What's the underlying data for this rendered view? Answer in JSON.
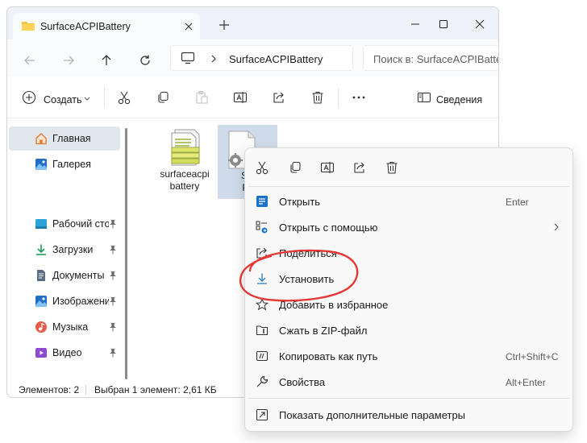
{
  "window": {
    "tab_title": "SurfaceACPIBattery",
    "address_path": "SurfaceACPIBattery",
    "search_placeholder": "Поиск в: SurfaceACPIBattery"
  },
  "toolbar": {
    "create_label": "Создать",
    "details_label": "Сведения"
  },
  "sidebar": {
    "items": [
      {
        "label": "Главная",
        "icon": "home-icon",
        "active": true
      },
      {
        "label": "Галерея",
        "icon": "gallery-icon"
      },
      {
        "label": "Рабочий стол",
        "icon": "desktop-icon",
        "pinned": true
      },
      {
        "label": "Загрузки",
        "icon": "downloads-icon",
        "pinned": true
      },
      {
        "label": "Документы",
        "icon": "documents-icon",
        "pinned": true
      },
      {
        "label": "Изображения",
        "icon": "pictures-icon",
        "pinned": true
      },
      {
        "label": "Музыка",
        "icon": "music-icon",
        "pinned": true
      },
      {
        "label": "Видео",
        "icon": "videos-icon",
        "pinned": true
      }
    ]
  },
  "files": [
    {
      "name_line1": "surfaceacpi",
      "name_line2": "battery",
      "icon": "catalog-file-icon",
      "selected": false
    },
    {
      "name_line1": "Surf",
      "name_line2": "PIB",
      "icon": "setup-info-file-icon",
      "selected": true
    }
  ],
  "status": {
    "count": "Элементов: 2",
    "selected": "Выбран 1 элемент: 2,61 КБ"
  },
  "context_menu": {
    "items": [
      {
        "label": "Открыть",
        "shortcut": "Enter",
        "icon": "open-icon"
      },
      {
        "label": "Открыть с помощью",
        "shortcut": "",
        "icon": "open-with-icon",
        "submenu": true
      },
      {
        "label": "Поделиться",
        "shortcut": "",
        "icon": "share-icon"
      },
      {
        "label": "Установить",
        "shortcut": "",
        "icon": "install-icon"
      },
      {
        "label": "Добавить в избранное",
        "shortcut": "",
        "icon": "favorite-icon"
      },
      {
        "label": "Сжать в ZIP-файл",
        "shortcut": "",
        "icon": "zip-icon"
      },
      {
        "label": "Копировать как путь",
        "shortcut": "Ctrl+Shift+C",
        "icon": "copy-path-icon"
      },
      {
        "label": "Свойства",
        "shortcut": "Alt+Enter",
        "icon": "properties-icon"
      },
      {
        "label": "Показать дополнительные параметры",
        "shortcut": "",
        "icon": "more-options-icon"
      }
    ]
  },
  "colors": {
    "accent": "#0067c0",
    "annotation": "#e53935",
    "selection": "#cfdbea"
  }
}
